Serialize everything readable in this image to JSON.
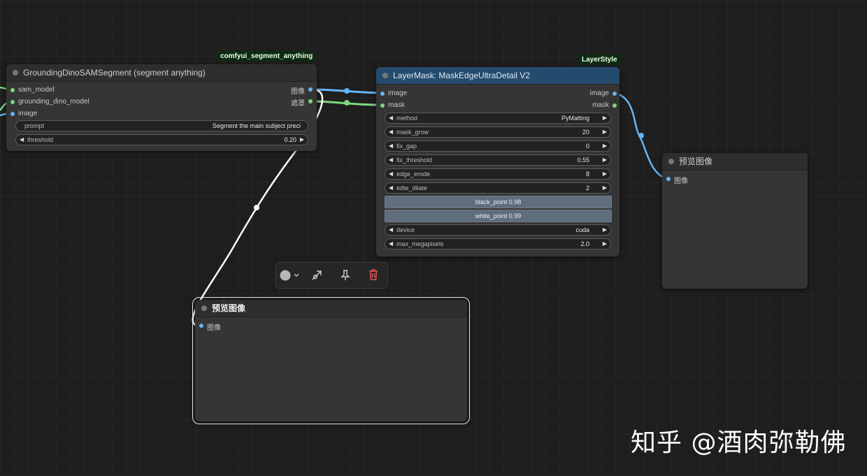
{
  "badges": {
    "segment_anything": "comfyui_segment_anything",
    "layerstyle": "LayerStyle"
  },
  "grounding_node": {
    "title": "GroundingDinoSAMSegment (segment anything)",
    "inputs": [
      "sam_model",
      "grounding_dino_model",
      "image"
    ],
    "outputs": [
      "图像",
      "遮罩"
    ],
    "prompt_label": "prompt",
    "prompt_value": "Segment the main subject preci",
    "threshold_label": "threshold",
    "threshold_value": "0.20"
  },
  "mask_node": {
    "title": "LayerMask: MaskEdgeUltraDetail V2",
    "inputs": [
      "image",
      "mask"
    ],
    "outputs": [
      "image",
      "mask"
    ],
    "widgets": [
      {
        "label": "method",
        "value": "PyMatting"
      },
      {
        "label": "mask_grow",
        "value": "20"
      },
      {
        "label": "fix_gap",
        "value": "0"
      },
      {
        "label": "fix_threshold",
        "value": "0.55"
      },
      {
        "label": "edge_erode",
        "value": "8"
      },
      {
        "label": "edte_dilate",
        "value": "2"
      }
    ],
    "black_point": "black_point  0.98",
    "white_point": "white_point  0.99",
    "device_label": "device",
    "device_value": "cuda",
    "maxmp_label": "max_megapixels",
    "maxmp_value": "2.0"
  },
  "preview_right": {
    "title": "预览图像",
    "input": "图像"
  },
  "preview_bottom": {
    "title": "预览图像",
    "input": "图像"
  },
  "toolbar": {
    "icons": [
      "color-circle-icon",
      "chevron-down-icon",
      "bypass-icon",
      "pin-icon",
      "trash-icon"
    ]
  },
  "watermark": "知乎 @酒肉弥勒佛",
  "colors": {
    "image_link": "#64b5f6",
    "mask_link": "#7ed67e",
    "selected_link": "#ffffff",
    "title_blue": "#244b6e"
  }
}
